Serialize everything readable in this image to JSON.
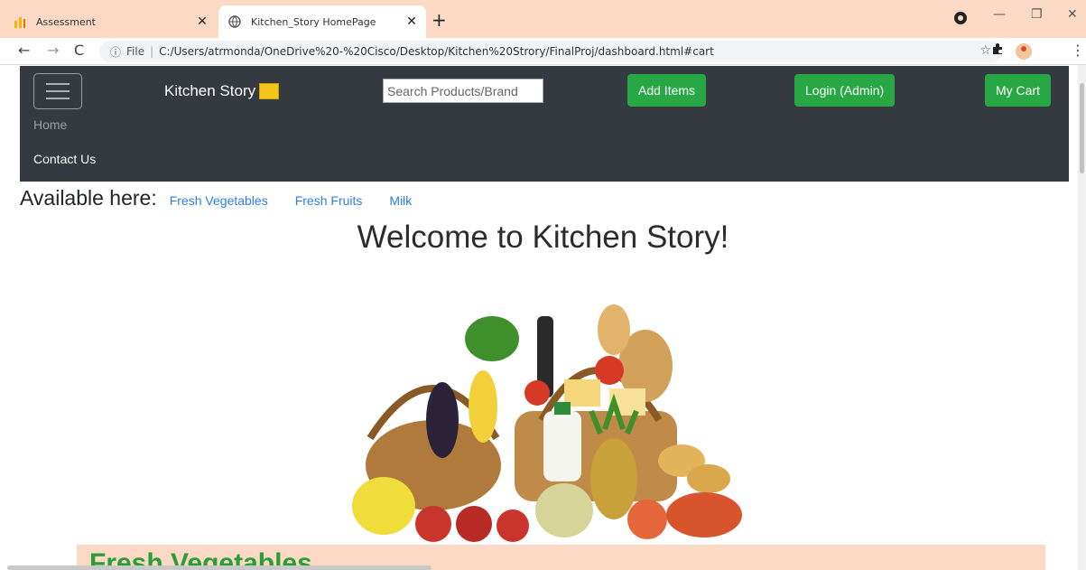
{
  "browser": {
    "tabs": [
      {
        "title": "Assessment",
        "icon": "bar-chart-icon"
      },
      {
        "title": "Kitchen_Story HomePage",
        "icon": "globe-icon"
      }
    ],
    "address": {
      "info_icon": "ⓘ",
      "scheme": "File",
      "url": "C:/Users/atrmonda/OneDrive%20-%20Cisco/Desktop/Kitchen%20Strory/FinalProj/dashboard.html#cart"
    }
  },
  "navbar": {
    "brand": "Kitchen Story",
    "search_placeholder": "Search Products/Brand",
    "add_items": "Add Items",
    "login": "Login (Admin)",
    "cart": "My Cart",
    "links": [
      "Home",
      "Contact Us"
    ]
  },
  "available": {
    "title": "Available here:",
    "links": [
      "Fresh Vegetables",
      "Fresh Fruits",
      "Milk"
    ]
  },
  "welcome": "Welcome to Kitchen Story!",
  "section": {
    "title": "Fresh Vegetables"
  },
  "colors": {
    "navbar_bg": "#343a40",
    "button_green": "#28a745",
    "link_blue": "#2f7de0",
    "accent_peach": "#fbd9c5",
    "section_title_green": "#2a9d3a"
  }
}
